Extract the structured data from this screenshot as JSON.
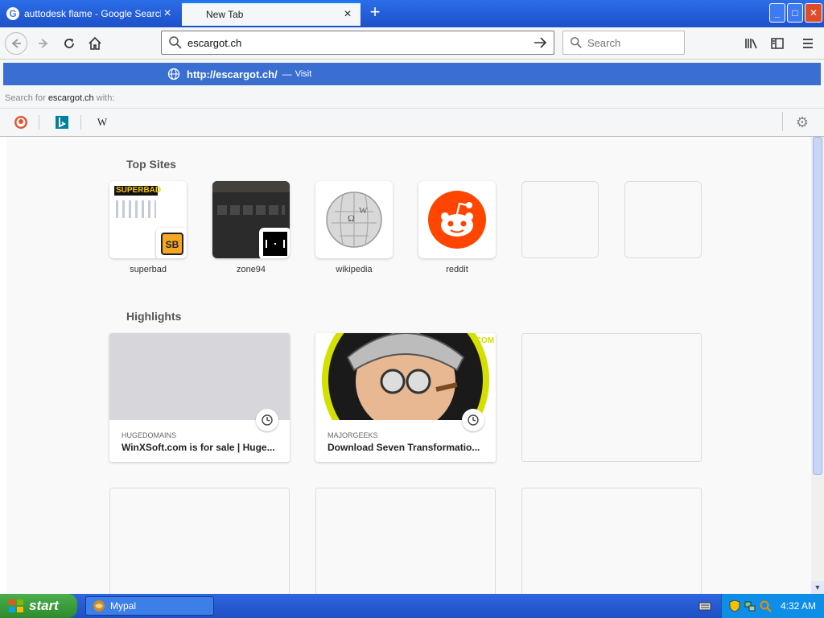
{
  "tabs": [
    {
      "title": "auttodesk flame - Google Search",
      "active": false,
      "favicon": "google-icon"
    },
    {
      "title": "New Tab",
      "active": true,
      "favicon": "none"
    }
  ],
  "window": {
    "minimize": "_",
    "maximize": "□",
    "close": "✕"
  },
  "navbar": {
    "url_value": "escargot.ch",
    "search_placeholder": "Search"
  },
  "popup": {
    "visit_url": "http://escargot.ch/",
    "visit_dash": "—",
    "visit_action": "Visit",
    "search_for_prefix": "Search for",
    "search_for_query": "escargot.ch",
    "search_for_suffix": "with:",
    "engines": [
      "duckduckgo-icon",
      "bing-icon",
      "wikipedia-icon"
    ]
  },
  "top_sites": {
    "heading": "Top Sites",
    "items": [
      {
        "label": "superbad"
      },
      {
        "label": "zone94"
      },
      {
        "label": "wikipedia"
      },
      {
        "label": "reddit"
      },
      {
        "label": ""
      },
      {
        "label": ""
      }
    ]
  },
  "highlights": {
    "heading": "Highlights",
    "items": [
      {
        "source": "HUGEDOMAINS",
        "title": "WinXSoft.com is for sale | Huge..."
      },
      {
        "source": "MAJORGEEKS",
        "title": "Download Seven Transformatio..."
      }
    ]
  },
  "taskbar": {
    "start_label": "start",
    "task_label": "Mypal",
    "clock": "4:32 AM"
  },
  "colors": {
    "accent": "#0a84ff",
    "visit_row": "#3a6fd1",
    "xp_blue": "#2f66e0",
    "xp_green": "#3d9e3d"
  }
}
